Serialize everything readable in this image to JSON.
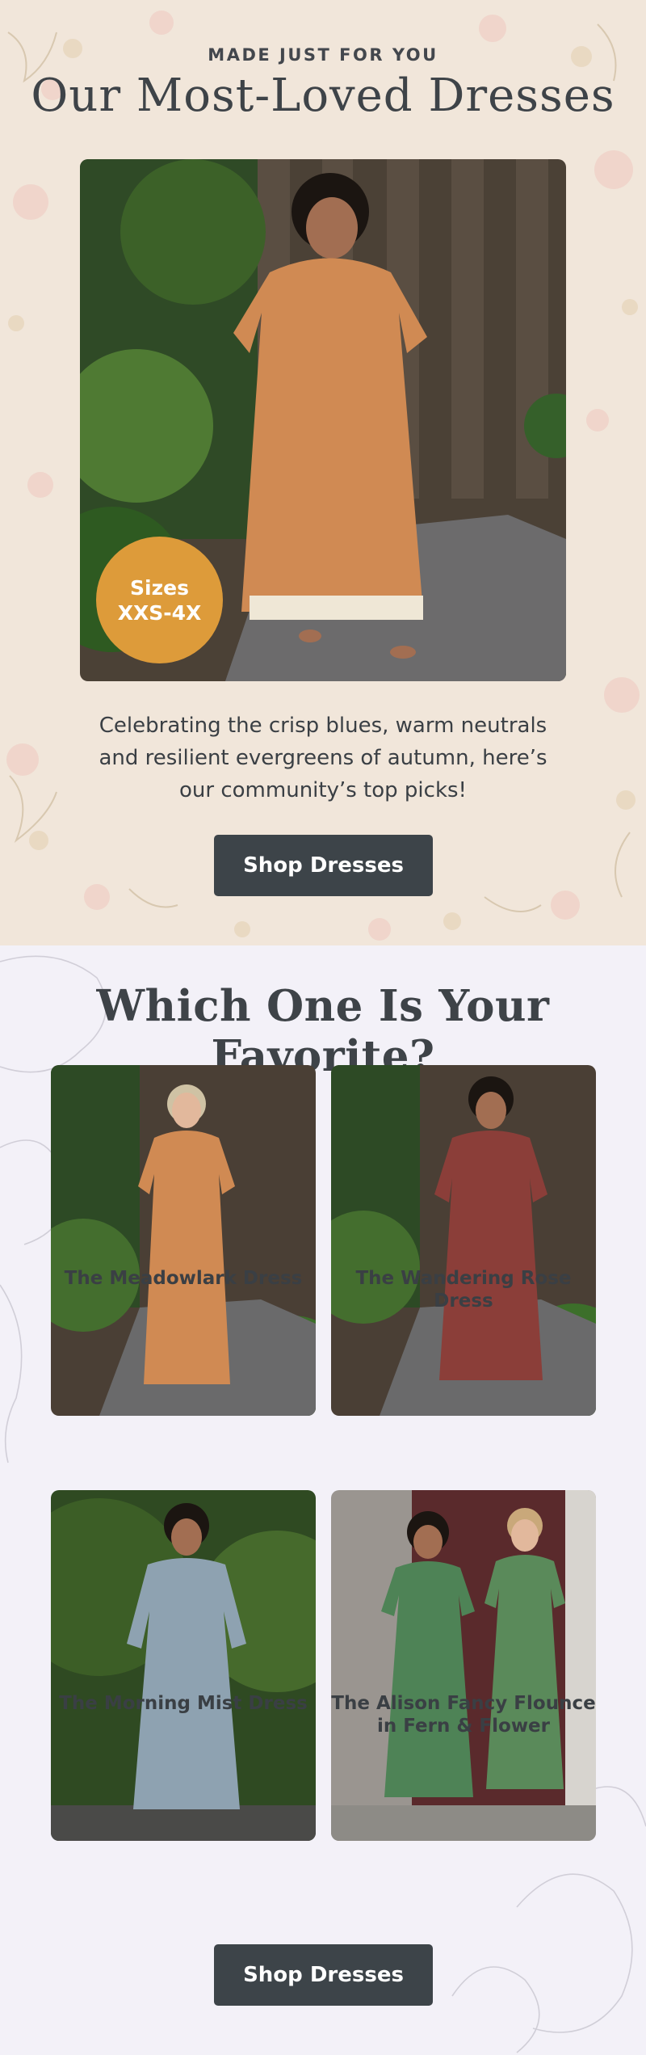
{
  "hero": {
    "eyebrow": "MADE JUST FOR YOU",
    "title": "Our Most-Loved Dresses",
    "badge_line1": "Sizes",
    "badge_line2": "XXS-4X",
    "copy": "Celebrating the crisp blues, warm neutrals and resilient evergreens of autumn, here’s our community’s top picks!",
    "cta_label": "Shop Dresses"
  },
  "favorites": {
    "title": "Which One Is Your Favorite?",
    "items": [
      {
        "label": "The Meadowlark Dress"
      },
      {
        "label": "The Wandering Rose Dress"
      },
      {
        "label": "The Morning Mist Dress"
      },
      {
        "label": "The Alison Fancy Flounce in Fern & Flower"
      }
    ],
    "cta_label": "Shop Dresses"
  },
  "colors": {
    "hero_bg": "#f1e6da",
    "section_bg": "#f3f1f8",
    "button": "#3d4449",
    "badge": "#dd9b3a",
    "text": "#3a3f44"
  }
}
